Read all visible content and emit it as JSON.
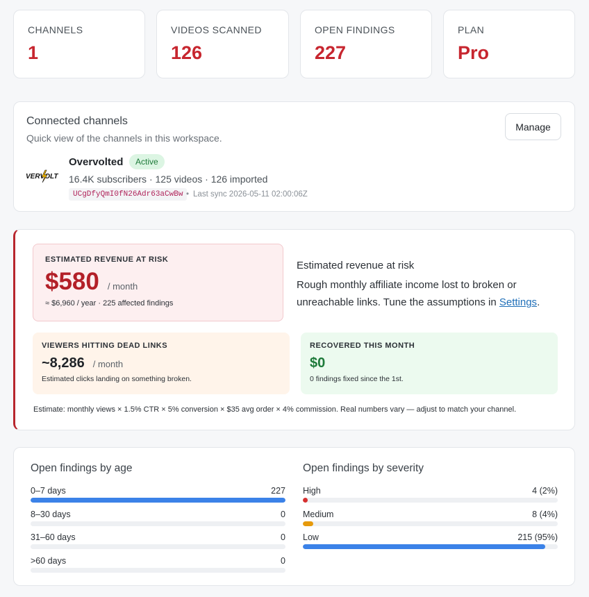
{
  "stats": [
    {
      "label": "CHANNELS",
      "value": "1"
    },
    {
      "label": "VIDEOS SCANNED",
      "value": "126"
    },
    {
      "label": "OPEN FINDINGS",
      "value": "227"
    },
    {
      "label": "PLAN",
      "value": "Pro"
    }
  ],
  "connected": {
    "title": "Connected channels",
    "subtitle": "Quick view of the channels in this workspace.",
    "manage_label": "Manage",
    "channel": {
      "logo_text": "VERVOLT",
      "name": "Overvolted",
      "status": "Active",
      "subscribers": "16.4K subscribers",
      "videos": "125 videos",
      "imported": "126 imported",
      "id": "UCgDfyQmI0fN26Adr63aCwBw",
      "last_sync": "Last sync 2026-05-11 02:00:06Z"
    }
  },
  "risk": {
    "box_label": "ESTIMATED REVENUE AT RISK",
    "amount": "$580",
    "per": "/ month",
    "note": "≈ $6,960 / year · 225 affected findings",
    "title": "Estimated revenue at risk",
    "desc": "Rough monthly affiliate income lost to broken or unreachable links. Tune the assumptions in",
    "link": "Settings",
    "desc_end": ".",
    "viewers": {
      "label": "VIEWERS HITTING DEAD LINKS",
      "value": "~8,286",
      "per": "/ month",
      "note": "Estimated clicks landing on something broken."
    },
    "recovered": {
      "label": "RECOVERED THIS MONTH",
      "value": "$0",
      "note": "0 findings fixed since the 1st."
    },
    "estimate": "Estimate: monthly views × 1.5% CTR × 5% conversion × $35 avg order × 4% commission. Real numbers vary — adjust to match your channel."
  },
  "age": {
    "title": "Open findings by age",
    "rows": [
      {
        "label": "0–7 days",
        "value": "227",
        "fraction": 1.0,
        "color": "#3b82e8"
      },
      {
        "label": "8–30 days",
        "value": "0",
        "fraction": 0,
        "color": "#3b82e8"
      },
      {
        "label": "31–60 days",
        "value": "0",
        "fraction": 0,
        "color": "#3b82e8"
      },
      {
        "label": ">60 days",
        "value": "0",
        "fraction": 0,
        "color": "#3b82e8"
      }
    ]
  },
  "severity": {
    "title": "Open findings by severity",
    "rows": [
      {
        "label": "High",
        "value": "4 (2%)",
        "fraction": 0.02,
        "color": "#d62f2f"
      },
      {
        "label": "Medium",
        "value": "8 (4%)",
        "fraction": 0.04,
        "color": "#e69a0c"
      },
      {
        "label": "Low",
        "value": "215 (95%)",
        "fraction": 0.95,
        "color": "#3b82e8"
      }
    ]
  }
}
